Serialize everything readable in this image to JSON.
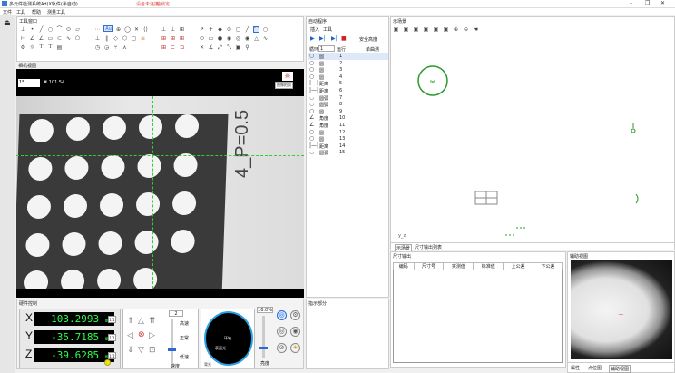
{
  "app": {
    "title": "多元件检测系统Ad(X轨件(半自动)",
    "warn1": "设备未连接",
    "warn2": "轴锁定"
  },
  "menu": [
    "文件",
    "工具",
    "帮助",
    "测量工具"
  ],
  "window": {
    "minimize": "–",
    "maximize": "❐",
    "close": "✕"
  },
  "tools_panel": {
    "title": "工具窗口",
    "selected_tool": "Au"
  },
  "camera": {
    "title": "相机视图",
    "field_value": "15",
    "live_value": "# 101.54",
    "snap_label": "图像拍照",
    "measurement_text": "4_P=0.5"
  },
  "program": {
    "title": "自动程序",
    "tab_insert": "插入",
    "tab_tools": "工具",
    "safety_label": "安全高度",
    "col_loop": "循环",
    "col_loop_val": "1",
    "col_run": "运行",
    "col_single": "单曲测",
    "selected_index": "1",
    "rows": [
      {
        "type": "圆",
        "n": "1"
      },
      {
        "type": "圆",
        "n": "2"
      },
      {
        "type": "圆",
        "n": "3"
      },
      {
        "type": "圆",
        "n": "4"
      },
      {
        "type": "距离",
        "n": "5"
      },
      {
        "type": "距离",
        "n": "6"
      },
      {
        "type": "圆弧",
        "n": "7"
      },
      {
        "type": "圆弧",
        "n": "8"
      },
      {
        "type": "圆",
        "n": "9"
      },
      {
        "type": "角度",
        "n": "10"
      },
      {
        "type": "角度",
        "n": "11"
      },
      {
        "type": "圆",
        "n": "12"
      },
      {
        "type": "圆",
        "n": "13"
      },
      {
        "type": "距离",
        "n": "14"
      },
      {
        "type": "圆弧",
        "n": "15"
      }
    ]
  },
  "scene": {
    "title": "示场景",
    "tab1": "示场景",
    "tab2": "尺寸输出列表",
    "axis_label": "y_z"
  },
  "size_output": {
    "title": "尺寸输出",
    "headers": [
      "编码",
      "尺寸号",
      "实测值",
      "标准值",
      "上公差",
      "下公差"
    ]
  },
  "aux": {
    "title": "辅助视图",
    "tabs": [
      "属性",
      "点位图",
      "辅助视图"
    ]
  },
  "hw": {
    "title": "硬件控制",
    "x_label": "X",
    "x_value": "103.2993",
    "y_label": "Y",
    "y_value": "-35.7185",
    "z_label": "Z",
    "z_value": "-39.6285",
    "unit": "mm",
    "step_btn": "1/1",
    "speed_value": "2",
    "speed_fast": "高速",
    "speed_normal": "正常",
    "speed_slow": "低速",
    "speed_level": "速度",
    "ring_label1": "环轴",
    "ring_label2": "表面光",
    "ring_label3": "背光",
    "zoom_value": "16.0",
    "zoom_unit": "%",
    "light_label": "亮度",
    "speed_slider": 0.35,
    "light_slider": 0.25
  },
  "status": {
    "title": "指示部分"
  }
}
